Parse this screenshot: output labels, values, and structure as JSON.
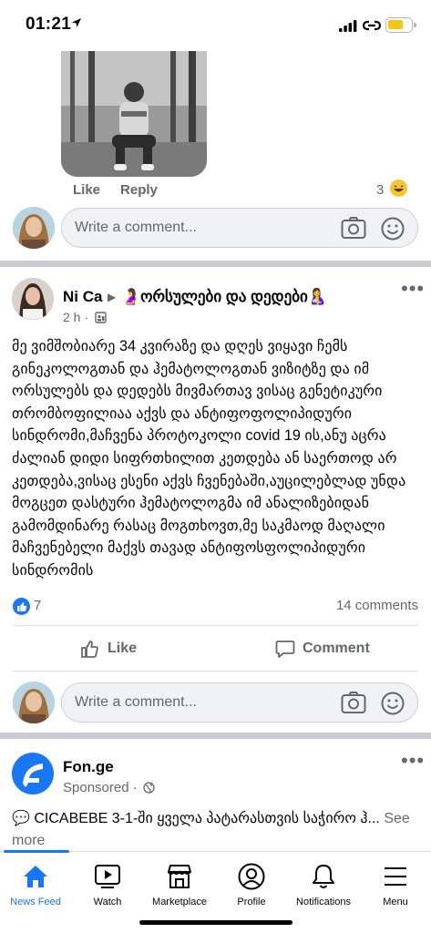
{
  "status_bar": {
    "time": "01:21"
  },
  "top_comment": {
    "like_label": "Like",
    "reply_label": "Reply",
    "reaction_count": "3"
  },
  "comment_box": {
    "placeholder": "Write a comment..."
  },
  "post": {
    "author": "Ni Ca",
    "group": "🤰ორსულები და დედები🤱",
    "time": "2 h ·",
    "text": "მე ვიმშობიარე 34 კვირაზე და დღეს ვიყავი ჩემს გინეკოლოგთან და ჰემატოლოგთან ვიზიტზე და იმ ორსულებს და დედებს მივმართავ ვისაც გენეტიკური თრომბოფილიაა აქვს და ანტიფოფოლიპიდური სინდრომი,მაჩვენა პროტოკოლი covid 19 ის,ანუ აცრა ძალიან დიდი სიფრთხილით კეთდება ან საერთოდ არ კეთდება,ვისაც ესენი აქვს ჩვენებაში,აუცილებლად უნდა მოგცეთ დასტური ჰემატოლოგმა იმ ანალიზებიდან გამომდინარე რასაც მოგთხოვთ,მე საკმაოდ მაღალი მაჩვენებელი მაქვს თავად ანტიფოსფოლიპიდური სინდრომის",
    "likes": "7",
    "comments": "14 comments",
    "like_label": "Like",
    "comment_label": "Comment"
  },
  "sponsored_post": {
    "name": "Fon.ge",
    "sponsored_label": "Sponsored ·",
    "text": "💬 CICABEBE 3-1-ში ყველა პატარასთვის საჭირო ჰ...",
    "see_more": " See more"
  },
  "bottom_nav": [
    {
      "label": "News Feed",
      "icon": "home-icon",
      "active": true
    },
    {
      "label": "Watch",
      "icon": "watch-icon",
      "active": false
    },
    {
      "label": "Marketplace",
      "icon": "marketplace-icon",
      "active": false
    },
    {
      "label": "Profile",
      "icon": "profile-icon",
      "active": false
    },
    {
      "label": "Notifications",
      "icon": "bell-icon",
      "active": false
    },
    {
      "label": "Menu",
      "icon": "menu-icon",
      "active": false
    }
  ],
  "colors": {
    "accent": "#1877f2",
    "secondary_text": "#65676b",
    "divider": "#c9ccd1"
  }
}
